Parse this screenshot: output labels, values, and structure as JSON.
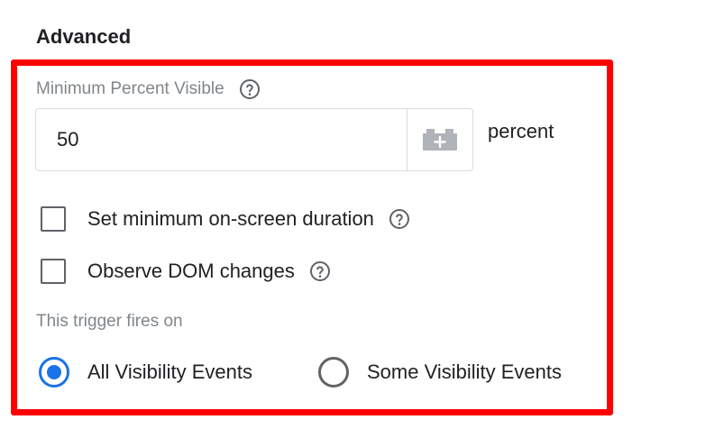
{
  "section": {
    "title": "Advanced"
  },
  "min_percent": {
    "label": "Minimum Percent Visible",
    "value": "50",
    "unit": "percent",
    "help_icon": "help-circle-icon",
    "variable_icon": "variable-brick-icon"
  },
  "options": {
    "min_duration_label": "Set minimum on-screen duration",
    "min_duration_checked": false,
    "observe_dom_label": "Observe DOM changes",
    "observe_dom_checked": false
  },
  "fires_on": {
    "label": "This trigger fires on",
    "all_label": "All Visibility Events",
    "some_label": "Some Visibility Events",
    "selected": "all"
  },
  "colors": {
    "highlight": "#ff0000",
    "accent": "#1a73e8",
    "muted_text": "#80868b"
  }
}
